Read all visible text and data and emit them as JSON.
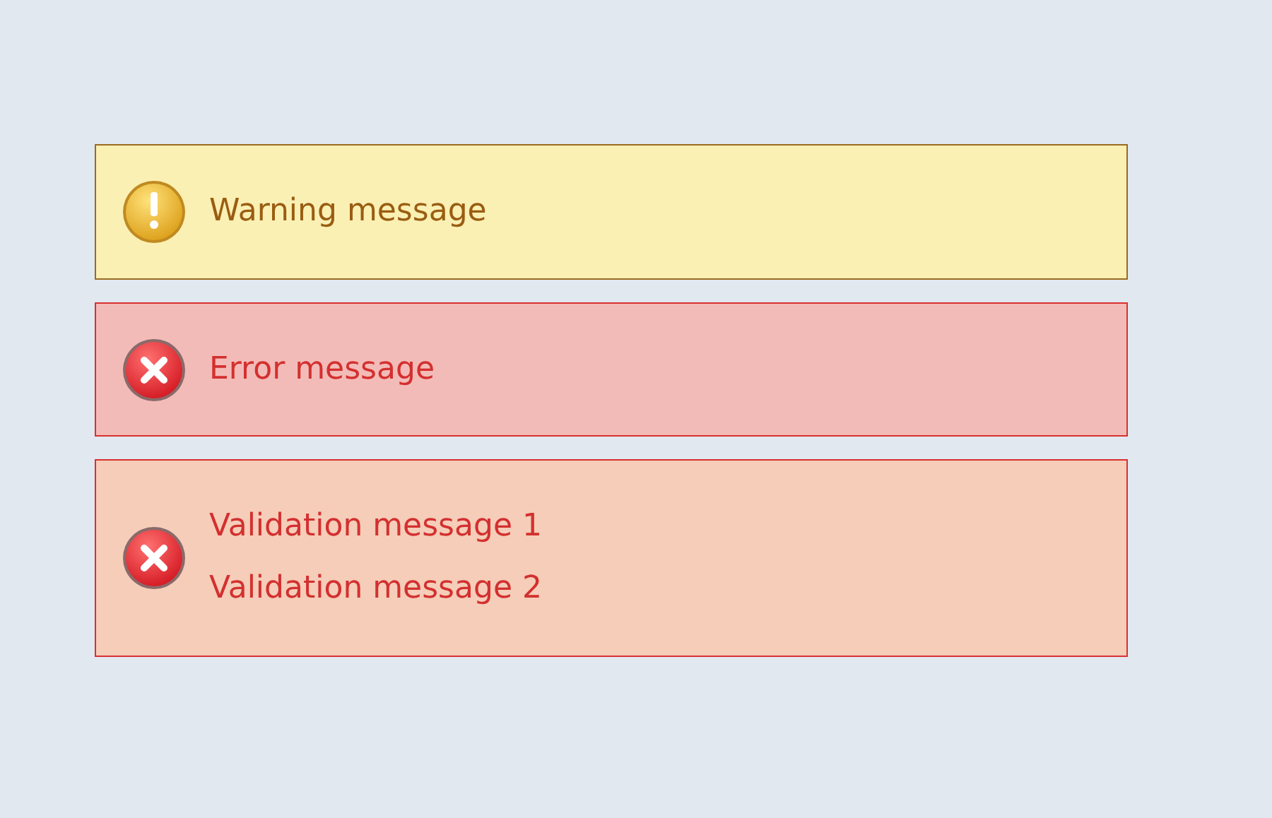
{
  "messages": [
    {
      "kind": "warning",
      "lines": [
        "Warning message"
      ]
    },
    {
      "kind": "error",
      "lines": [
        "Error message"
      ]
    },
    {
      "kind": "validation",
      "lines": [
        "Validation message 1",
        "Validation message 2"
      ]
    }
  ]
}
